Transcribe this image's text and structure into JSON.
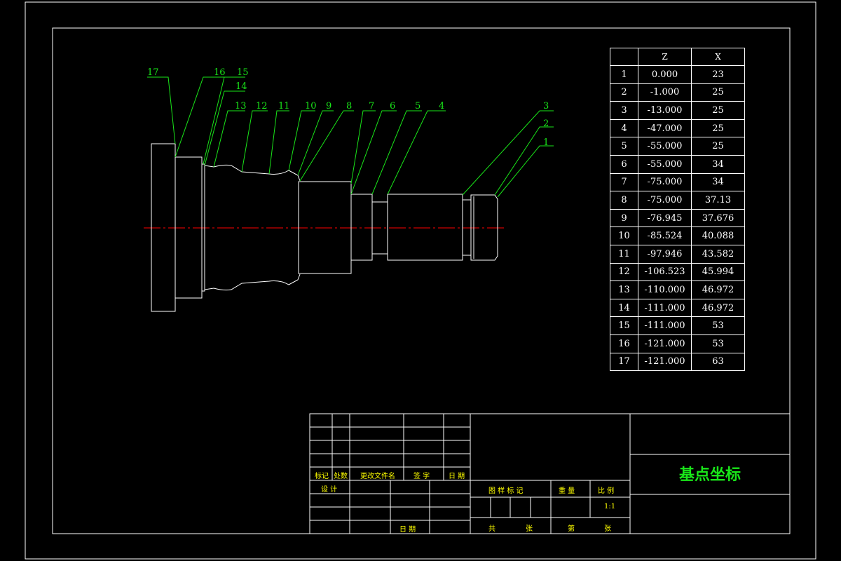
{
  "drawing_title": "基点坐标",
  "table": {
    "headers": [
      "",
      "Z",
      "X"
    ],
    "rows": [
      {
        "no": "1",
        "z": "0.000",
        "x": "23"
      },
      {
        "no": "2",
        "z": "-1.000",
        "x": "25"
      },
      {
        "no": "3",
        "z": "-13.000",
        "x": "25"
      },
      {
        "no": "4",
        "z": "-47.000",
        "x": "25"
      },
      {
        "no": "5",
        "z": "-55.000",
        "x": "25"
      },
      {
        "no": "6",
        "z": "-55.000",
        "x": "34"
      },
      {
        "no": "7",
        "z": "-75.000",
        "x": "34"
      },
      {
        "no": "8",
        "z": "-75.000",
        "x": "37.13"
      },
      {
        "no": "9",
        "z": "-76.945",
        "x": "37.676"
      },
      {
        "no": "10",
        "z": "-85.524",
        "x": "40.088"
      },
      {
        "no": "11",
        "z": "-97.946",
        "x": "43.582"
      },
      {
        "no": "12",
        "z": "-106.523",
        "x": "45.994"
      },
      {
        "no": "13",
        "z": "-110.000",
        "x": "46.972"
      },
      {
        "no": "14",
        "z": "-111.000",
        "x": "46.972"
      },
      {
        "no": "15",
        "z": "-111.000",
        "x": "53"
      },
      {
        "no": "16",
        "z": "-121.000",
        "x": "53"
      },
      {
        "no": "17",
        "z": "-121.000",
        "x": "63"
      }
    ]
  },
  "point_labels": [
    "1",
    "2",
    "3",
    "4",
    "5",
    "6",
    "7",
    "8",
    "9",
    "10",
    "11",
    "12",
    "13",
    "14",
    "15",
    "16",
    "17"
  ],
  "title_block": {
    "mark": "标记",
    "count": "处数",
    "change_doc": "更改文件名",
    "signature": "签 字",
    "date": "日 期",
    "design": "设 计",
    "date2": "日 期",
    "stage_mark": "图 样 标 记",
    "weight": "重 量",
    "scale_label": "比 例",
    "scale_value": "1:1",
    "total": "共",
    "sheets1": "张",
    "page": "第",
    "sheets2": "张"
  },
  "colors": {
    "line": "#ffffff",
    "leader": "#19e619",
    "center": "#ff0000",
    "title_text": "#ffff00"
  }
}
